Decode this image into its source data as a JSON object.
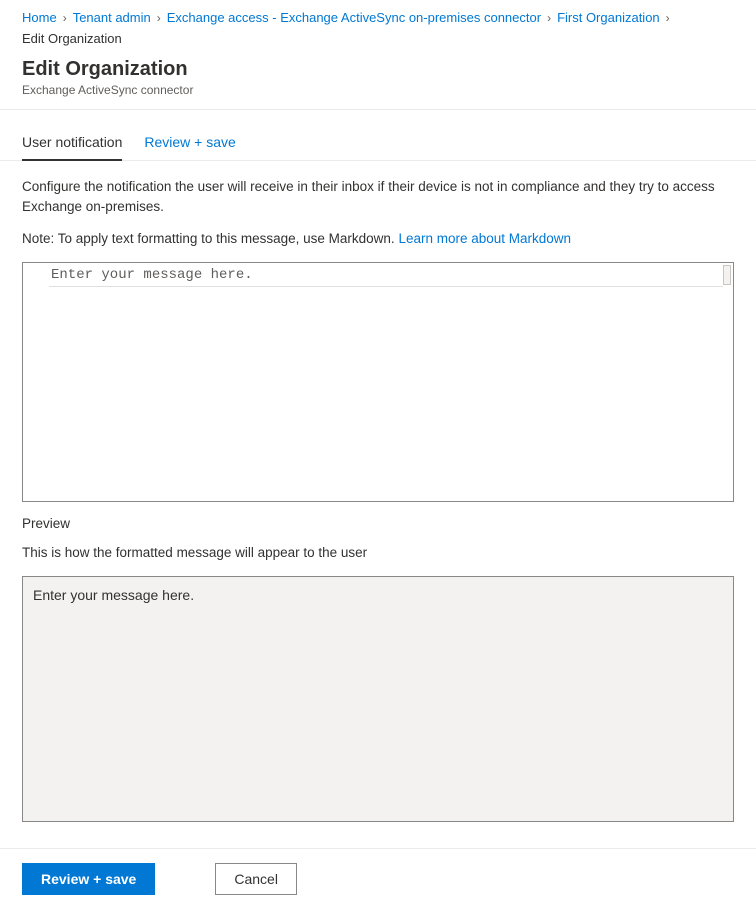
{
  "breadcrumb": {
    "items": [
      {
        "label": "Home"
      },
      {
        "label": "Tenant admin"
      },
      {
        "label": "Exchange access - Exchange ActiveSync on-premises connector"
      },
      {
        "label": "First Organization"
      }
    ],
    "current": "Edit Organization"
  },
  "header": {
    "title": "Edit Organization",
    "subtitle": "Exchange ActiveSync connector"
  },
  "tabs": {
    "user_notification": "User notification",
    "review_save": "Review + save"
  },
  "content": {
    "description": "Configure the notification the user will receive in their inbox if their device is not in compliance and they try to access Exchange on-premises.",
    "note_prefix": "Note: To apply text formatting to this message, use Markdown. ",
    "markdown_link": "Learn more about Markdown",
    "editor_text": "Enter your message here.",
    "preview_label": "Preview",
    "preview_desc": "This is how the formatted message will appear to the user",
    "preview_text": "Enter your message here."
  },
  "footer": {
    "review_save": "Review + save",
    "cancel": "Cancel"
  }
}
